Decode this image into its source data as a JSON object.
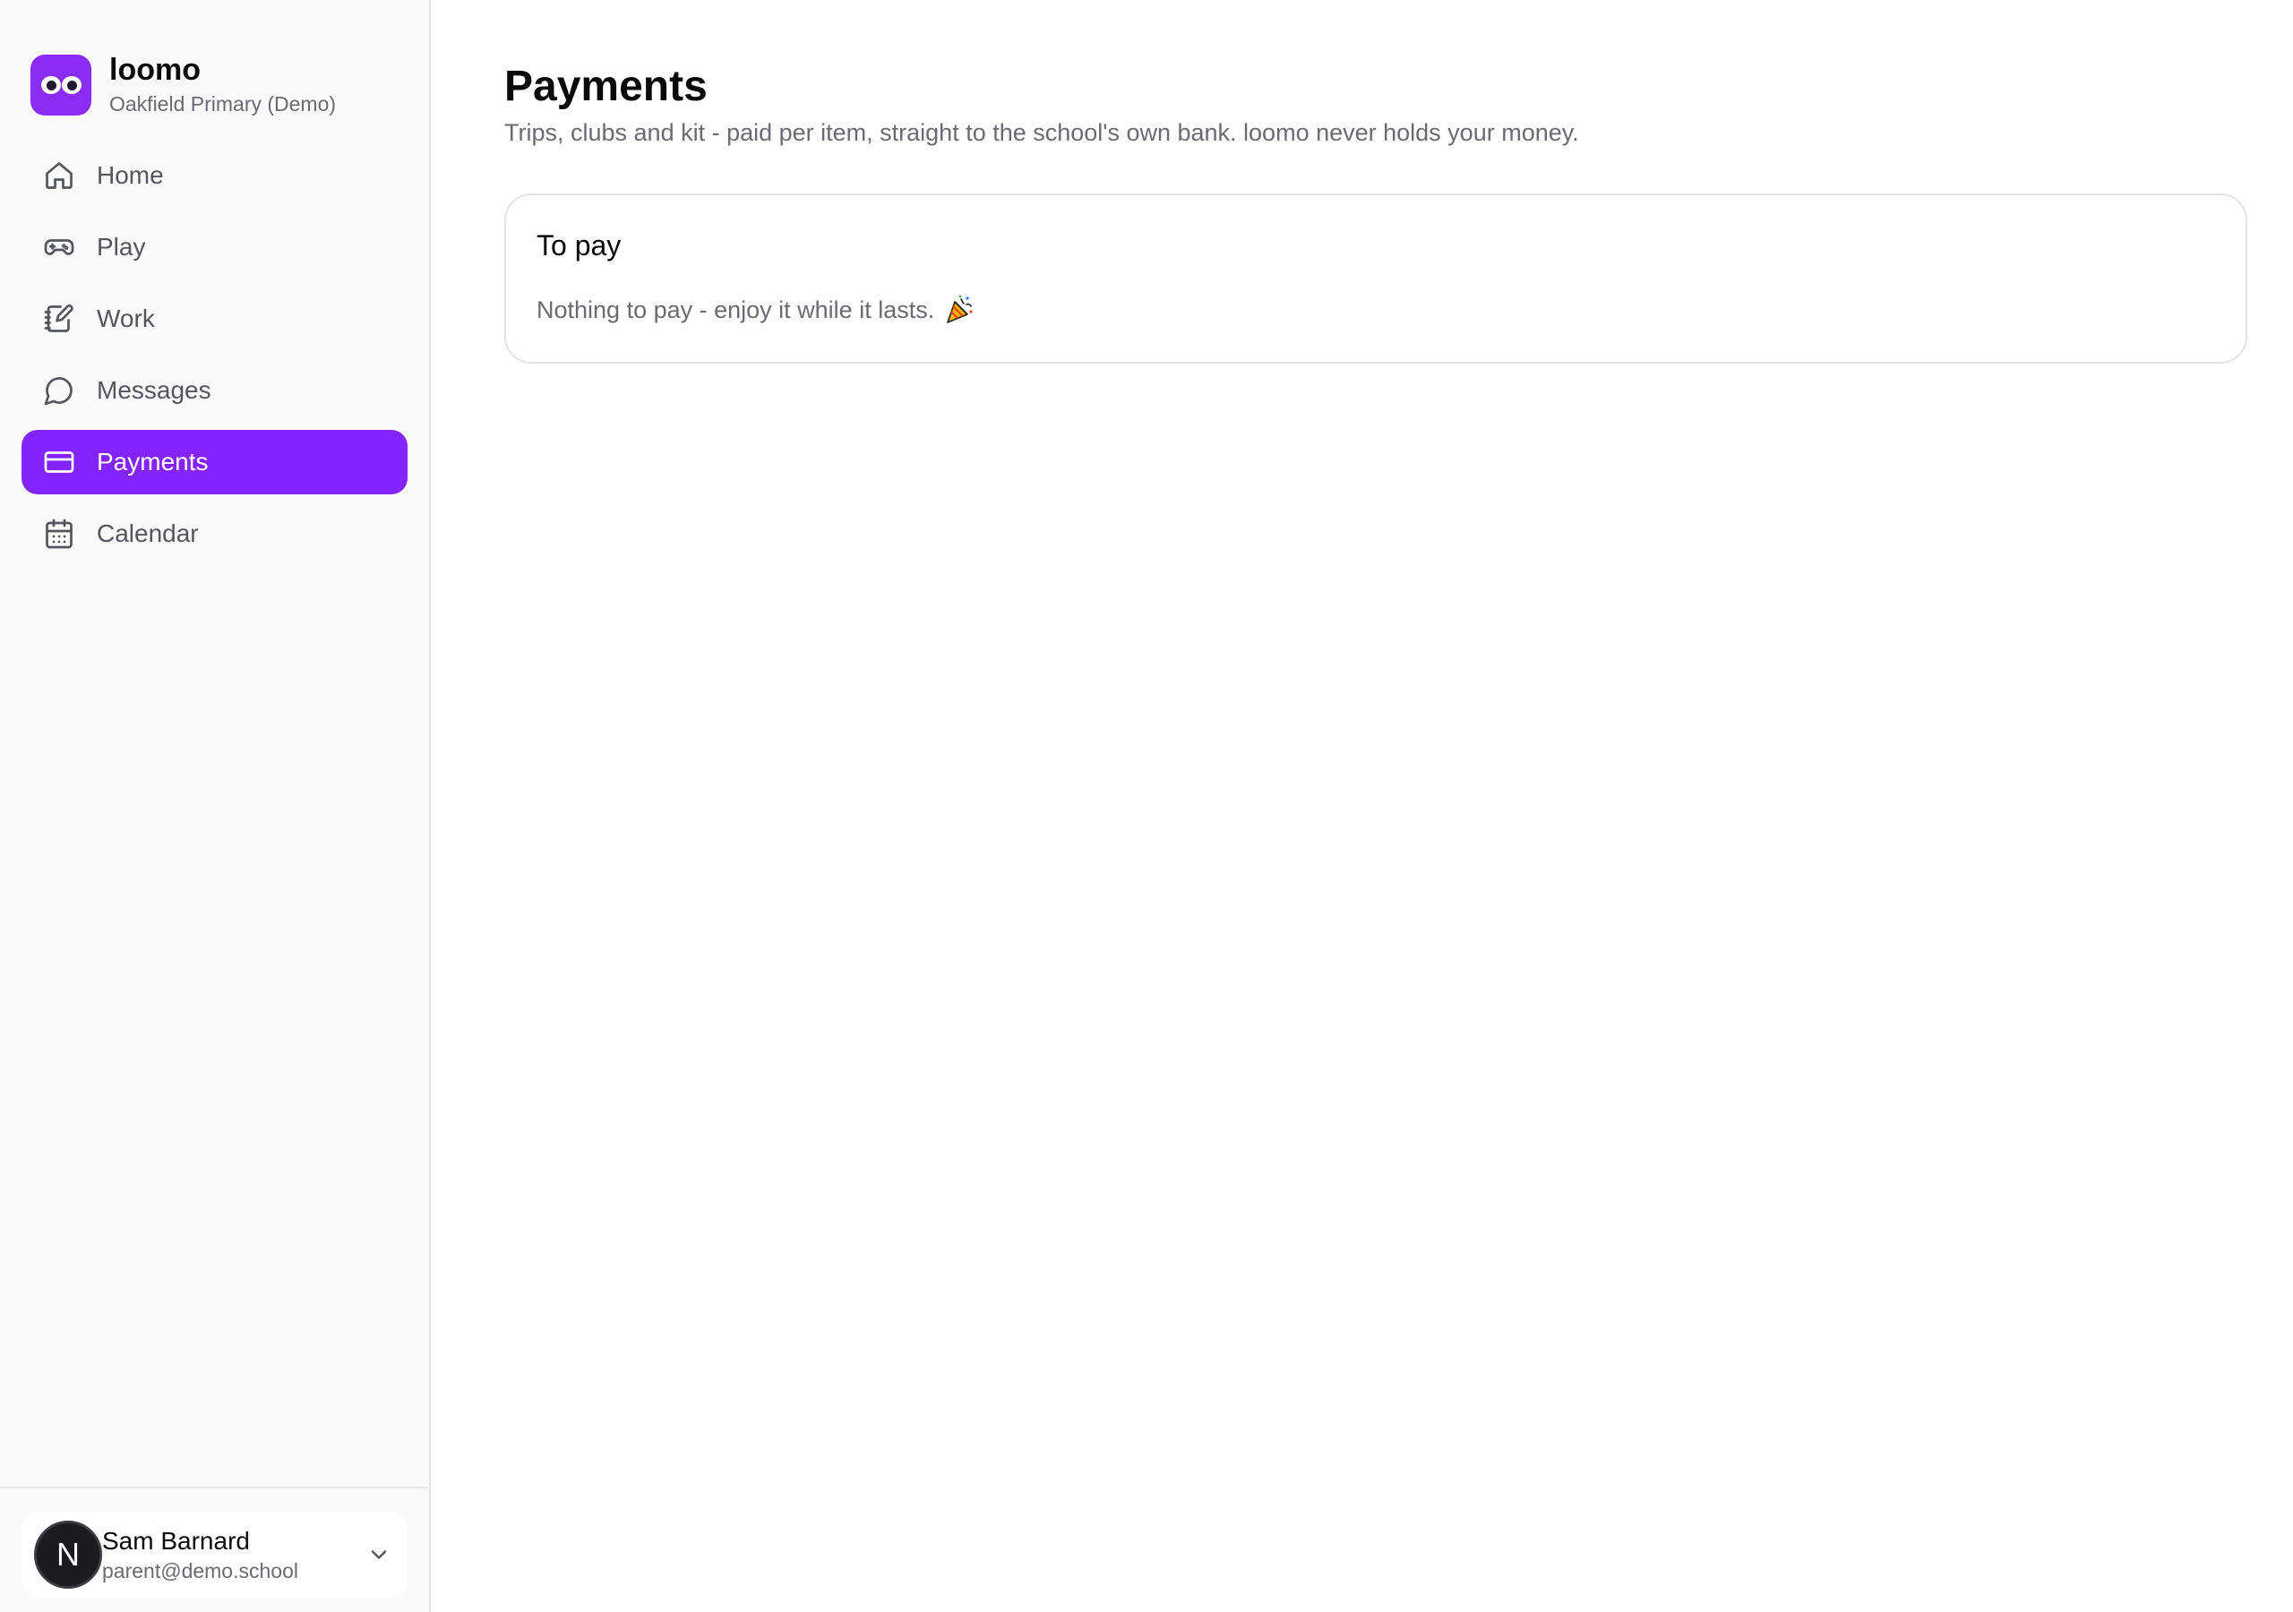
{
  "brand": {
    "name": "loomo",
    "subtitle": "Oakfield Primary (Demo)",
    "logo_icon": "eyes-logo-icon",
    "accent_color": "#8224fb"
  },
  "sidebar": {
    "items": [
      {
        "label": "Home",
        "icon": "home-icon",
        "active": false
      },
      {
        "label": "Play",
        "icon": "gamepad-icon",
        "active": false
      },
      {
        "label": "Work",
        "icon": "notebook-pen-icon",
        "active": false
      },
      {
        "label": "Messages",
        "icon": "chat-bubble-icon",
        "active": false
      },
      {
        "label": "Payments",
        "icon": "credit-card-icon",
        "active": true
      },
      {
        "label": "Calendar",
        "icon": "calendar-icon",
        "active": false
      }
    ]
  },
  "user": {
    "avatar_letter": "N",
    "name": "Sam Barnard",
    "email": "parent@demo.school",
    "menu_icon": "chevron-down-icon"
  },
  "main": {
    "title": "Payments",
    "subtitle": "Trips, clubs and kit - paid per item, straight to the school's own bank. loomo never holds your money.",
    "to_pay": {
      "title": "To pay",
      "empty_message": "Nothing to pay - enjoy it while it lasts.",
      "empty_icon": "party-popper-icon"
    }
  }
}
